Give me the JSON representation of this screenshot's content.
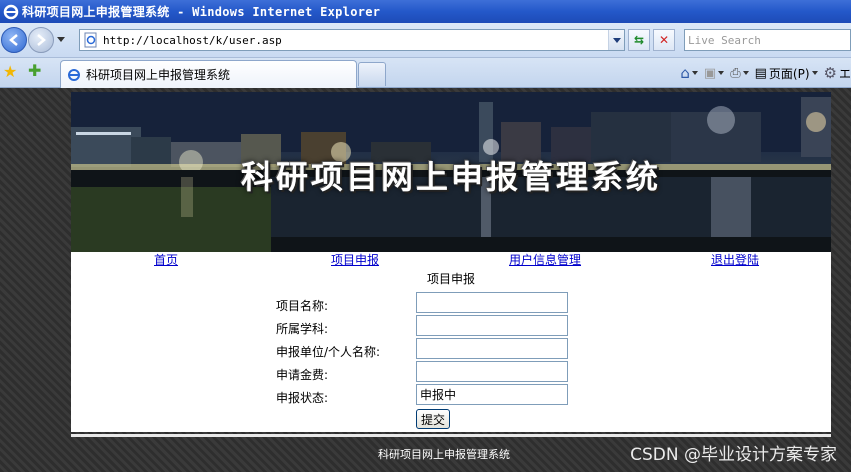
{
  "window": {
    "title": "科研项目网上申报管理系统 - Windows Internet Explorer"
  },
  "address_bar": {
    "url": "http://localhost/k/user.asp"
  },
  "search": {
    "placeholder": "Live Search"
  },
  "tab": {
    "label": "科研项目网上申报管理系统"
  },
  "tools": {
    "page_label": "页面(P)"
  },
  "banner": {
    "title": "科研项目网上申报管理系统"
  },
  "nav": {
    "items": [
      {
        "label": "首页"
      },
      {
        "label": "项目申报"
      },
      {
        "label": "用户信息管理"
      },
      {
        "label": "退出登陆"
      }
    ]
  },
  "form": {
    "section_title": "项目申报",
    "fields": [
      {
        "label": "项目名称:",
        "value": ""
      },
      {
        "label": "所属学科:",
        "value": ""
      },
      {
        "label": "申报单位/个人名称:",
        "value": ""
      },
      {
        "label": "申请金费:",
        "value": ""
      },
      {
        "label": "申报状态:",
        "value": "申报中"
      }
    ],
    "submit_label": "提交"
  },
  "footer": {
    "text": "科研项目网上申报管理系统"
  },
  "watermark": {
    "text": "CSDN @毕业设计方案专家"
  }
}
